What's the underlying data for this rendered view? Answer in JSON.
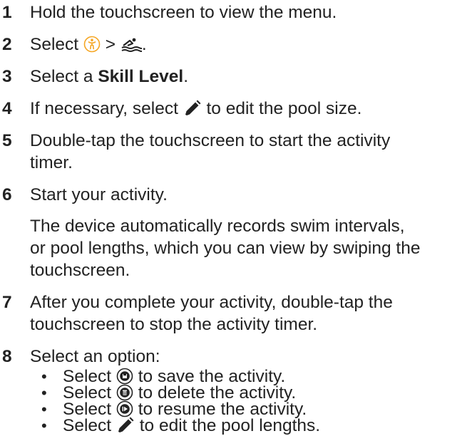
{
  "steps": [
    {
      "number": "1",
      "text": "Hold the touchscreen to view the menu."
    },
    {
      "number": "2",
      "prefix": "Select ",
      "separator": " > ",
      "suffix": ".",
      "icon_a": "activity-person-icon",
      "icon_b": "pool-swim-icon"
    },
    {
      "number": "3",
      "prefix": "Select a ",
      "bold": "Skill Level",
      "suffix": "."
    },
    {
      "number": "4",
      "prefix": "If necessary, select ",
      "suffix": " to edit the pool size.",
      "icon": "pencil-edit-icon"
    },
    {
      "number": "5",
      "line1": "Double-tap the touchscreen to start the activity",
      "line2": "timer."
    },
    {
      "number": "6",
      "text": "Start your activity.",
      "note_lines": [
        "The device automatically records swim intervals,",
        "or pool lengths, which you can view by swiping the",
        "touchscreen."
      ]
    },
    {
      "number": "7",
      "line1": "After you complete your activity, double-tap the",
      "line2": "touchscreen to stop the activity timer."
    },
    {
      "number": "8",
      "text": "Select an option:"
    }
  ],
  "options": [
    {
      "bullet": "•",
      "prefix": "Select ",
      "suffix": " to save the activity.",
      "icon": "save-icon"
    },
    {
      "bullet": "•",
      "prefix": "Select ",
      "suffix": " to delete the activity.",
      "icon": "delete-icon"
    },
    {
      "bullet": "•",
      "prefix": "Select ",
      "suffix": " to resume the activity.",
      "icon": "resume-play-icon"
    },
    {
      "bullet": "•",
      "prefix": "Select ",
      "suffix": " to edit the pool lengths.",
      "icon": "pencil-edit-icon"
    }
  ],
  "colors": {
    "accent_orange": "#f5a623",
    "text": "#222222"
  }
}
